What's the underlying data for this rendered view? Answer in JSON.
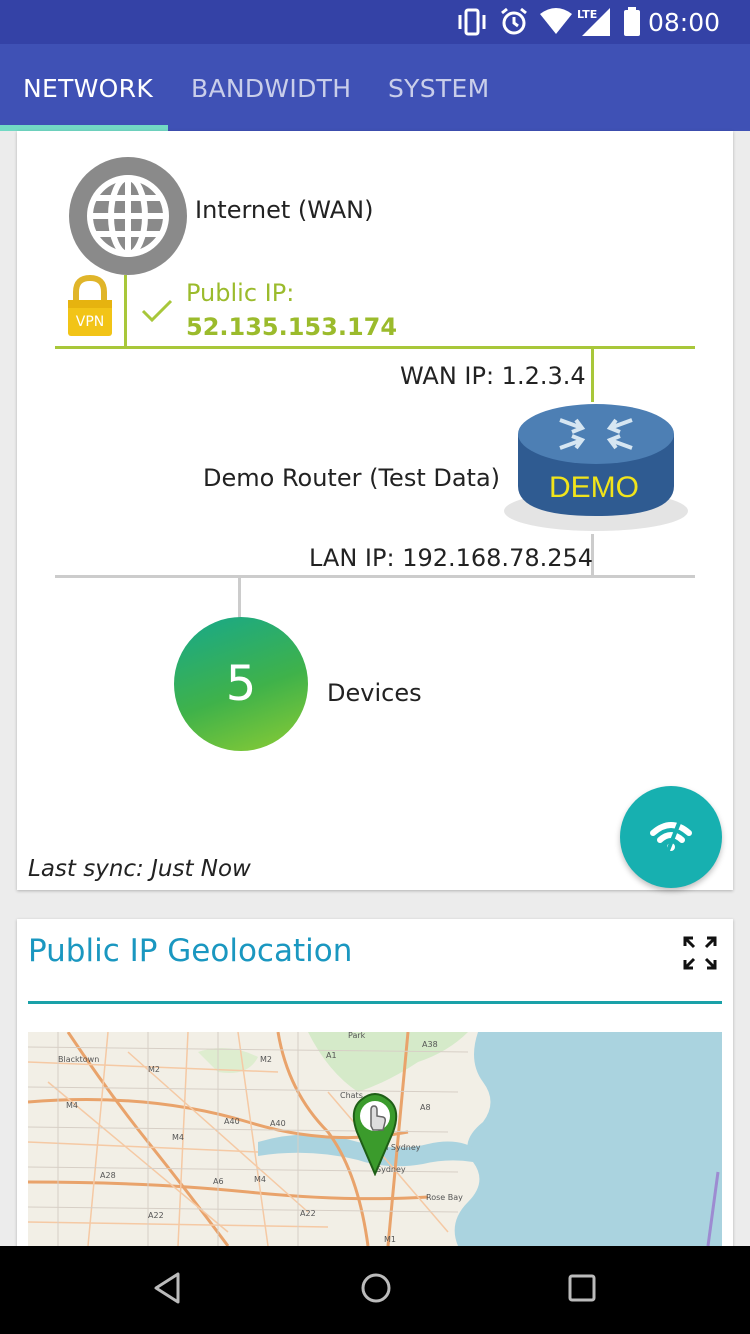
{
  "status_bar": {
    "time": "08:00",
    "network_type": "LTE",
    "icons": [
      "vibrate-icon",
      "alarm-icon",
      "wifi-icon",
      "lte-signal-icon",
      "battery-icon"
    ]
  },
  "tabs": [
    {
      "label": "NETWORK",
      "active": true
    },
    {
      "label": "BANDWIDTH",
      "active": false
    },
    {
      "label": "SYSTEM",
      "active": false
    }
  ],
  "network": {
    "internet_label": "Internet (WAN)",
    "vpn_badge": "VPN",
    "public_ip_label": "Public IP:",
    "public_ip": "52.135.153.174",
    "wan_ip": "WAN IP: 1.2.3.4",
    "router_name": "Demo Router (Test Data)",
    "router_badge": "DEMO",
    "lan_ip": "LAN IP: 192.168.78.254",
    "device_count": "5",
    "devices_label": "Devices",
    "last_sync": "Last sync: Just Now"
  },
  "geolocation": {
    "title": "Public IP Geolocation",
    "map_labels": [
      "Blacktown",
      "M2",
      "M2",
      "A1",
      "A38",
      "M4",
      "A40",
      "A40",
      "Chats",
      "A8",
      "M4",
      "North Sydney",
      "Sydney",
      "A28",
      "A6",
      "M4",
      "A22",
      "A22",
      "Rose Bay",
      "M1",
      "Park"
    ]
  },
  "colors": {
    "status_bar": "#3442a6",
    "tab_bar": "#3f51b5",
    "tab_indicator": "#72d9c4",
    "accent_lime": "#9bbb2c",
    "accent_teal": "#17b0b0",
    "title_blue": "#1a97c0"
  }
}
